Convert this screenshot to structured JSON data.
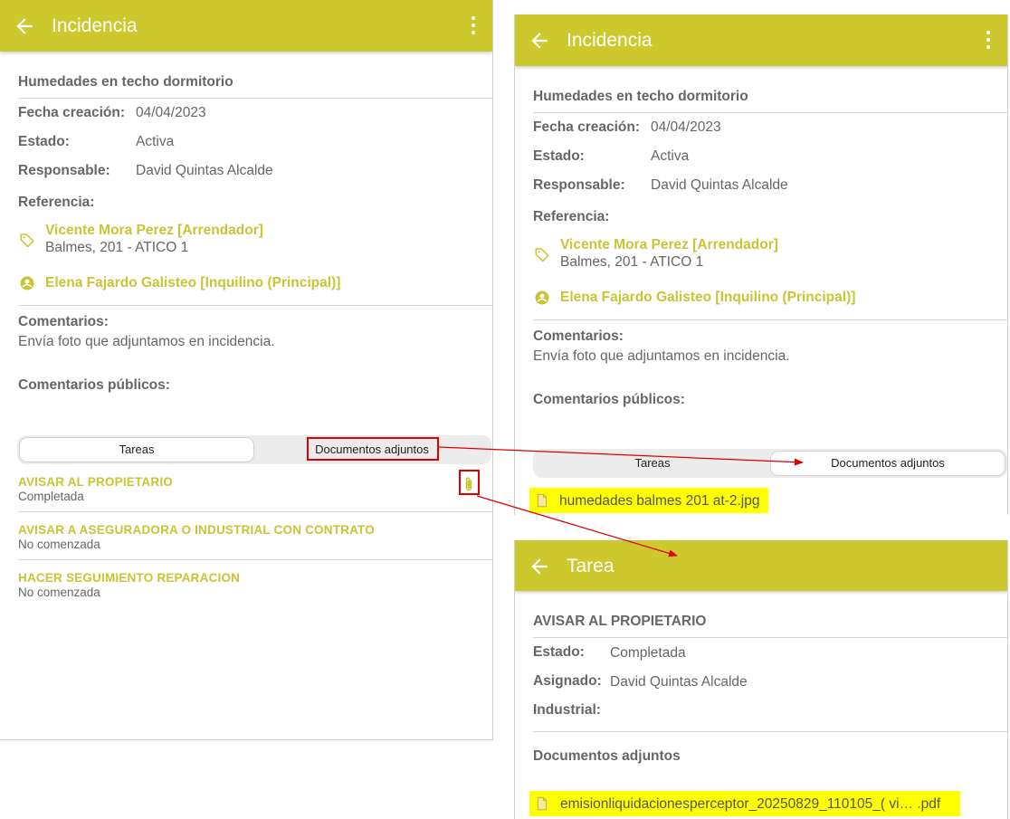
{
  "colors": {
    "accent": "#cdc82e",
    "link": "#c9c434",
    "highlight": "#ffff00",
    "annotation": "#e00000"
  },
  "incidencia": {
    "title": "Incidencia",
    "subject": "Humedades en techo dormitorio",
    "fecha_label": "Fecha creación:",
    "fecha_value": "04/04/2023",
    "estado_label": "Estado:",
    "estado_value": "Activa",
    "responsable_label": "Responsable:",
    "responsable_value": "David Quintas Alcalde",
    "referencia_label": "Referencia:",
    "ref_owner_name": "Vicente Mora Perez [Arrendador]",
    "ref_owner_address": "Balmes, 201 - ATICO 1",
    "ref_tenant_name": "Elena Fajardo Galisteo [Inquilino (Principal)]",
    "comentarios_label": "Comentarios:",
    "comentarios_value": "Envía foto que adjuntamos en incidencia.",
    "comentarios_publicos_label": "Comentarios públicos:",
    "tab_tareas": "Tareas",
    "tab_documentos": "Documentos adjuntos"
  },
  "tasks": [
    {
      "name": "AVISAR AL PROPIETARIO",
      "status": "Completada"
    },
    {
      "name": "AVISAR A ASEGURADORA O INDUSTRIAL CON CONTRATO",
      "status": "No comenzada"
    },
    {
      "name": "HACER SEGUIMIENTO REPARACION",
      "status": "No comenzada"
    }
  ],
  "incidencia_documents": [
    "humedades balmes 201 at-2.jpg"
  ],
  "tarea": {
    "title": "Tarea",
    "name": "AVISAR AL PROPIETARIO",
    "estado_label": "Estado:",
    "estado_value": "Completada",
    "asignado_label": "Asignado:",
    "asignado_value": "David Quintas Alcalde",
    "industrial_label": "Industrial:",
    "documentos_label": "Documentos adjuntos",
    "document": "emisionliquidacionesperceptor_20250829_110105_( vi… .pdf"
  },
  "icons": [
    "back-arrow-icon",
    "more-vert-icon",
    "tag-icon",
    "account-circle-icon",
    "paperclip-icon",
    "document-icon"
  ]
}
